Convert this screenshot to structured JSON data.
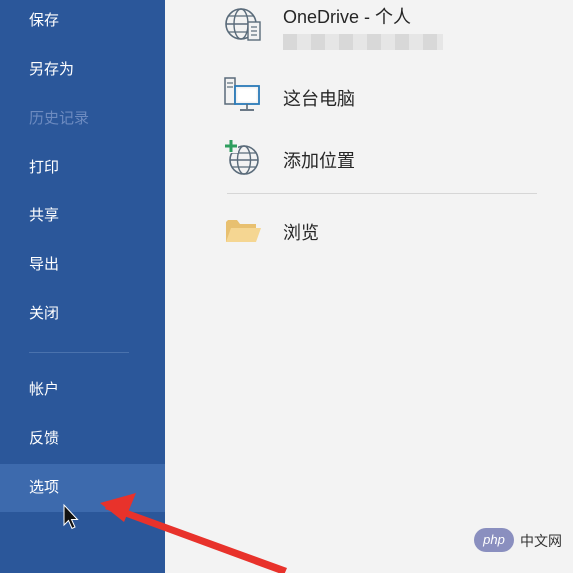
{
  "sidebar": {
    "items": [
      {
        "label": "保存",
        "state": "normal"
      },
      {
        "label": "另存为",
        "state": "normal"
      },
      {
        "label": "历史记录",
        "state": "disabled"
      },
      {
        "label": "打印",
        "state": "normal"
      },
      {
        "label": "共享",
        "state": "normal"
      },
      {
        "label": "导出",
        "state": "normal"
      },
      {
        "label": "关闭",
        "state": "normal"
      },
      {
        "label": "帐户",
        "state": "normal"
      },
      {
        "label": "反馈",
        "state": "normal"
      },
      {
        "label": "选项",
        "state": "selected"
      }
    ]
  },
  "locations": {
    "onedrive": {
      "label": "OneDrive - 个人",
      "icon": "globe-icon"
    },
    "this_pc": {
      "label": "这台电脑",
      "icon": "computer-icon"
    },
    "add_place": {
      "label": "添加位置",
      "icon": "add-globe-icon"
    },
    "browse": {
      "label": "浏览",
      "icon": "folder-icon"
    }
  },
  "watermark": {
    "badge": "php",
    "text": "中文网"
  },
  "colors": {
    "sidebar": "#2b579a",
    "selected": "#3d6aad",
    "arrow": "#e8322b"
  }
}
